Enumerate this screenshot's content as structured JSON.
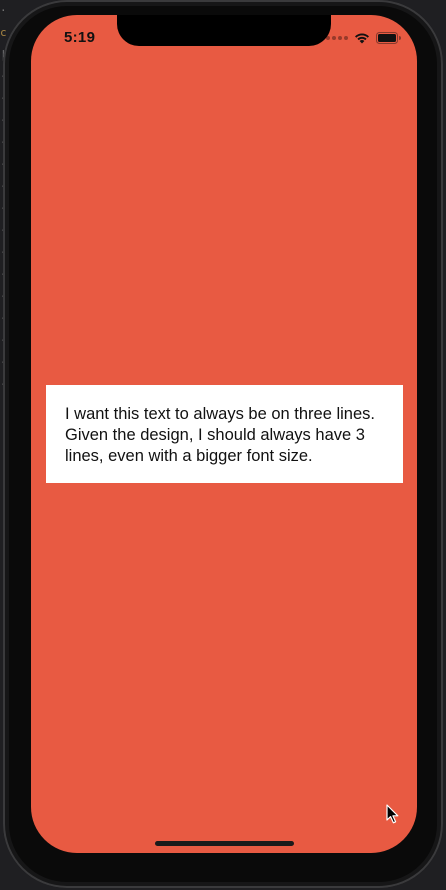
{
  "status_bar": {
    "time": "5:19"
  },
  "main": {
    "label_text": "I want this text to always be on three lines. Given the design, I should always have 3 lines, even with a bigger font size."
  },
  "colors": {
    "screen_background": "#e85a42",
    "card_background": "#ffffff",
    "text": "#111111"
  },
  "icons": {
    "wifi": "wifi-icon",
    "battery": "battery-icon",
    "signal": "cellular-signal-icon",
    "cursor": "mouse-pointer-icon"
  }
}
